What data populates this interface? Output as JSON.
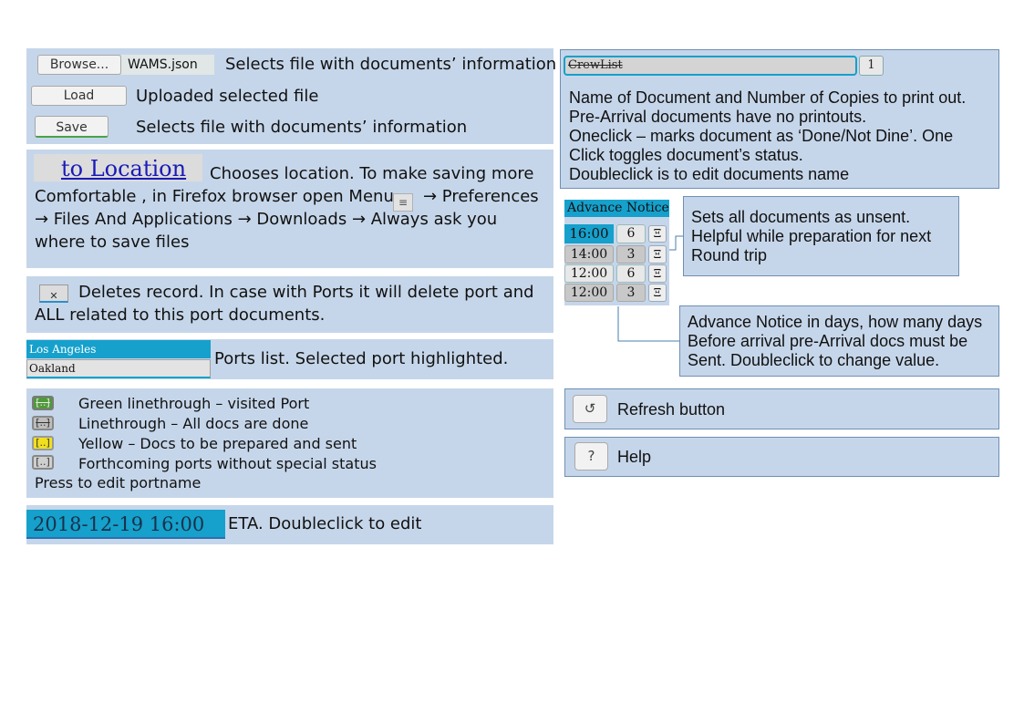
{
  "file_panel": {
    "browse_label": "Browse...",
    "file_name": "WAMS.json",
    "browse_desc": "Selects file with documents’ information",
    "load_label": "Load",
    "load_desc": "Uploaded selected file",
    "save_label": "Save",
    "save_desc": "Selects file with documents’ information"
  },
  "location_panel": {
    "link_label": "to Location",
    "line1": "Chooses location.  To make saving more",
    "line2_pre": "Comfortable , in Firefox browser open Menu",
    "menu_icon": "≡",
    "line2_post": "→ Preferences",
    "line3": "→ Files And Applications → Downloads → Always ask you",
    "line4": "where to save files"
  },
  "delete_panel": {
    "icon": "✕",
    "line1": "Deletes record. In case with Ports it will delete port and",
    "line2": "ALL related to this port documents."
  },
  "ports_panel": {
    "ports": [
      "Los Angeles",
      "Oakland"
    ],
    "desc": "Ports list. Selected port highlighted."
  },
  "legend_panel": {
    "items": [
      {
        "swatch": "[..]",
        "label": "Green linethrough – visited Port",
        "color": "#4f9a3a"
      },
      {
        "swatch": "[..]",
        "label": "Linethrough – All docs are done",
        "color": "#bdbdbd"
      },
      {
        "swatch": "[..]",
        "label": "Yellow – Docs to be prepared and sent",
        "color": "#f0e020"
      },
      {
        "swatch": "[..]",
        "label": "Forthcoming ports without special status",
        "color": "#cfcfcf"
      }
    ],
    "footer": "Press to edit portname"
  },
  "eta_panel": {
    "value": "2018-12-19 16:00",
    "desc": "ETA. Doubleclick to edit"
  },
  "doc_panel": {
    "doc_name": "CrewList",
    "copies": "1",
    "lines": [
      "Name of Document and Number of Copies to print out.",
      "Pre-Arrival documents have no printouts.",
      "Oneclick – marks document as ‘Done/Not Dine’. One",
      "Click toggles document’s status.",
      "Doubleclick is to edit documents name"
    ]
  },
  "advance_widget": {
    "header": "Advance Notice",
    "rows": [
      {
        "time": "16:00",
        "days": "6",
        "icon": "Ξ"
      },
      {
        "time": "14:00",
        "days": "3",
        "icon": "Ξ"
      },
      {
        "time": "12:00",
        "days": "6",
        "icon": "Ξ"
      },
      {
        "time": "12:00",
        "days": "3",
        "icon": "Ξ"
      }
    ]
  },
  "unsent_callout": {
    "lines": [
      "Sets all documents as unsent.",
      "Helpful while preparation for next",
      "Round trip"
    ]
  },
  "advance_callout": {
    "lines": [
      "Advance Notice in days, how many days",
      "Before arrival pre-Arrival docs must be",
      "Sent. Doubleclick to change value."
    ]
  },
  "refresh": {
    "icon": "↺",
    "label": "Refresh button"
  },
  "help": {
    "icon": "?",
    "label": "Help"
  },
  "colors": {
    "panel": "#c6d6ea",
    "accent": "#16a0cc",
    "border": "#6f8fb3"
  }
}
